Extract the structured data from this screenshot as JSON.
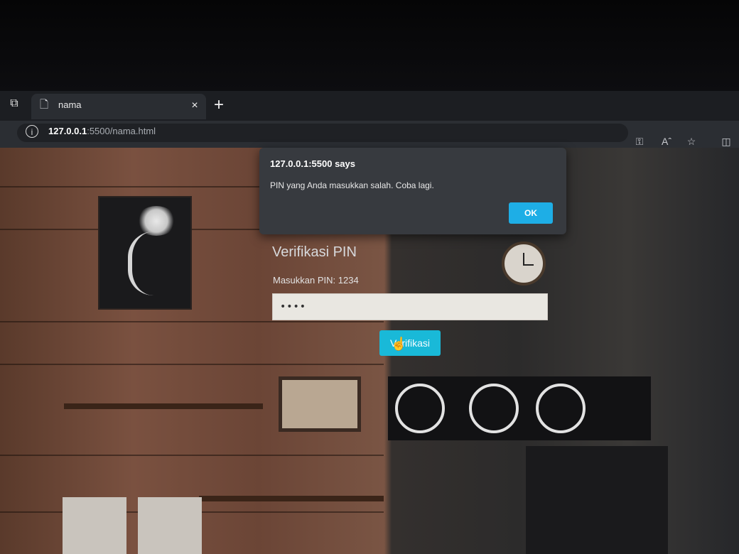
{
  "browser": {
    "tab_actions_icon": "tab-actions-icon",
    "tab": {
      "title": "nama",
      "favicon": "page-icon",
      "close_label": "×"
    },
    "new_tab_label": "+",
    "address": {
      "host": "127.0.0.1",
      "rest": ":5500/nama.html"
    },
    "toolbar_icons": [
      "key-icon",
      "read-aloud-icon",
      "favorite-star-icon",
      "split-screen-icon"
    ]
  },
  "dialog": {
    "title": "127.0.0.1:5500 says",
    "message": "PIN yang Anda masukkan salah. Coba lagi.",
    "ok_label": "OK"
  },
  "form": {
    "title": "Verifikasi PIN",
    "label": "Masukkan PIN: 1234",
    "pin_value": "••••",
    "button_label": "Verifikasi"
  },
  "colors": {
    "button": "#19b9d8",
    "dialog_ok": "#1eaee6",
    "dialog_bg": "#373a3f"
  }
}
